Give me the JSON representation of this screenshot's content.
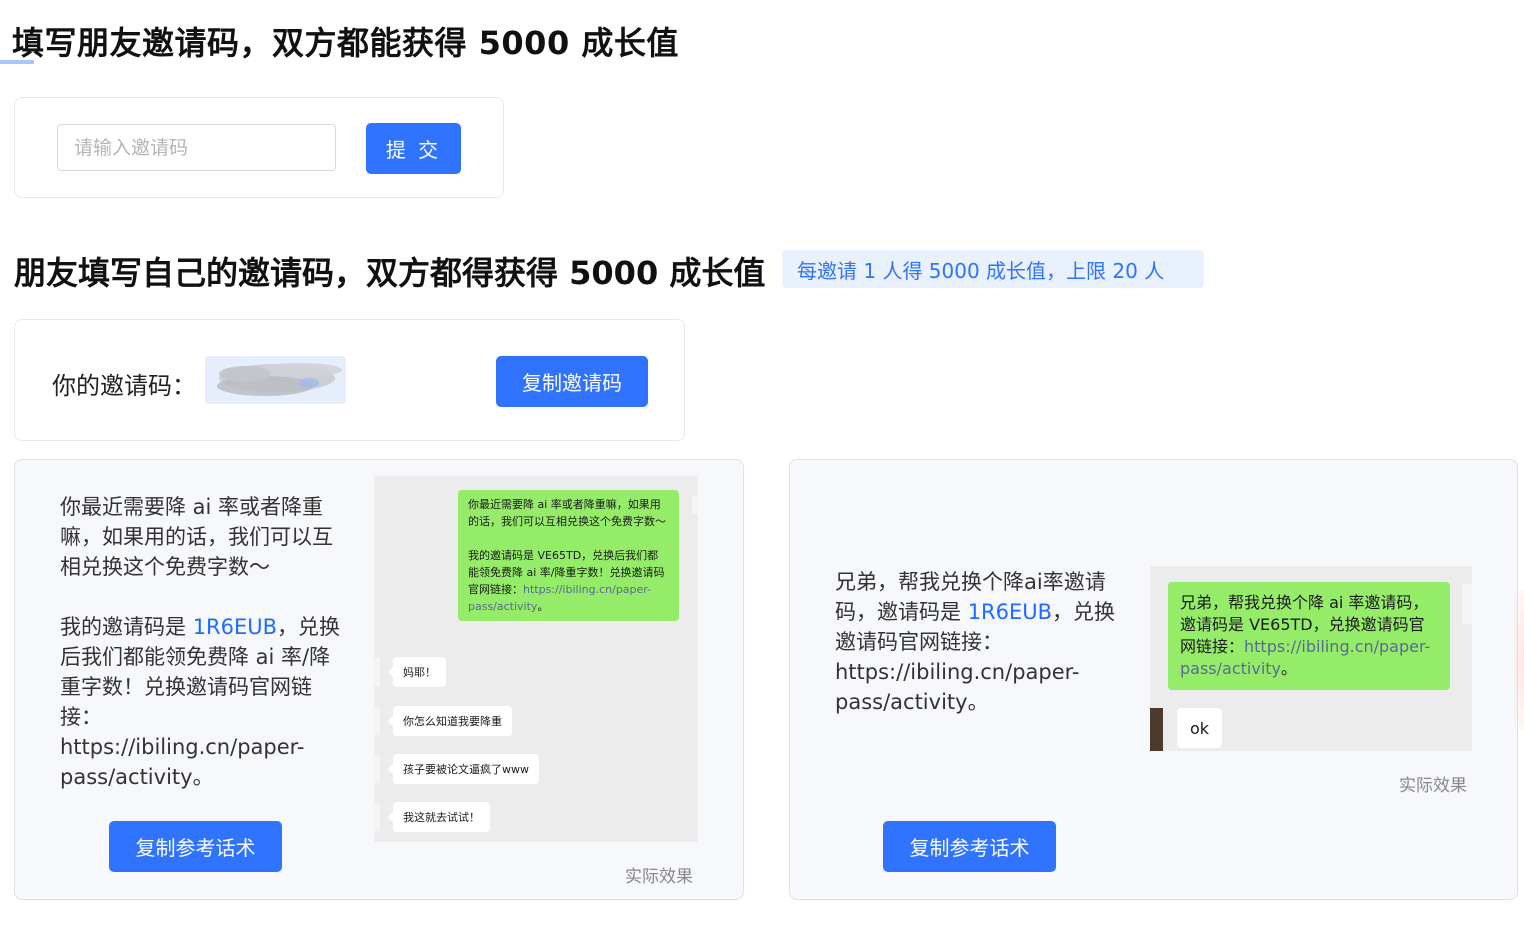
{
  "section1": {
    "title": "填写朋友邀请码，双方都能获得 5000 成长值",
    "input_placeholder": "请输入邀请码",
    "submit_label": "提 交"
  },
  "section2": {
    "title": "朋友填写自己的邀请码，双方都得获得 5000 成长值",
    "badge": "每邀请 1 人得 5000 成长值，上限 20 人",
    "code_label": "你的邀请码：",
    "copy_code_label": "复制邀请码"
  },
  "script_card_1": {
    "paragraph1": "你最近需要降 ai 率或者降重嘛，如果用的话，我们可以互相兑换这个免费字数～",
    "paragraph2_prefix": "我的邀请码是 ",
    "code": "1R6EUB",
    "paragraph2_suffix": "，兑换后我们都能领免费降 ai 率/降重字数！兑换邀请码官网链接：https://ibiling.cn/paper-pass/activity。",
    "copy_label": "复制参考话术",
    "effect_label": "实际效果",
    "chat": {
      "green_line1": "你最近需要降 ai 率或者降重嘛，如果用的话，我们可以互相兑换这个免费字数～",
      "green_line2_prefix": "我的邀请码是 VE65TD，兑换后我们都能领免费降 ai 率/降重字数！兑换邀请码官网链接：",
      "green_link": "https://ibiling.cn/paper-pass/activity",
      "green_line2_suffix": "。",
      "replies": [
        "妈耶！",
        "你怎么知道我要降重",
        "孩子要被论文逼疯了www",
        "我这就去试试！"
      ]
    }
  },
  "script_card_2": {
    "text_prefix": "兄弟，帮我兑换个降ai率邀请码，邀请码是 ",
    "code": "1R6EUB",
    "text_suffix": "，兑换邀请码官网链接：https://ibiling.cn/paper-pass/activity。",
    "copy_label": "复制参考话术",
    "effect_label": "实际效果",
    "chat": {
      "green_text": "兄弟，帮我兑换个降 ai 率邀请码，邀请码是 VE65TD，兑换邀请码官网链接：",
      "green_link": "https://ibiling.cn/paper-pass/activity",
      "green_suffix": "。",
      "reply": "ok"
    }
  },
  "colors": {
    "primary": "#2f73ff",
    "badge_bg": "#e9f1fd",
    "wechat_green": "#95ec69",
    "wechat_link": "#576b95"
  }
}
